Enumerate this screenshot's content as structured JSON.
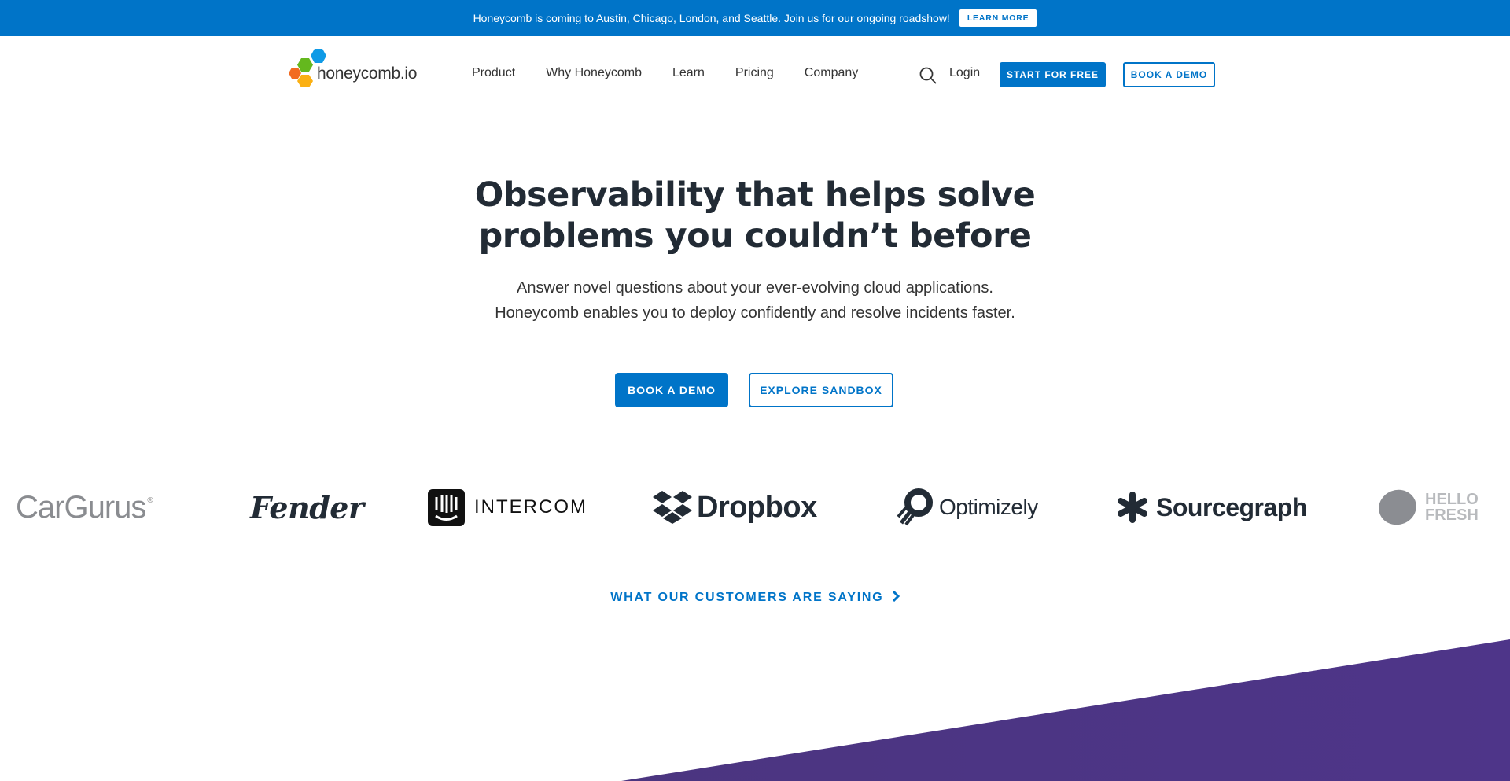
{
  "banner": {
    "text": "Honeycomb is coming to Austin, Chicago, London, and Seattle. Join us for our ongoing roadshow!",
    "button_label": "LEARN MORE",
    "background_color": "#0074c8"
  },
  "header": {
    "logo_text": "honeycomb.io",
    "nav_items": [
      {
        "label": "Product"
      },
      {
        "label": "Why Honeycomb"
      },
      {
        "label": "Learn"
      },
      {
        "label": "Pricing"
      },
      {
        "label": "Company"
      }
    ],
    "search_icon": "search-icon",
    "login_label": "Login",
    "start_button_label": "START FOR FREE",
    "demo_button_label": "BOOK A DEMO"
  },
  "hero": {
    "title_line1": "Observability that helps solve",
    "title_line2": "problems you couldn’t before",
    "subtitle_line1": "Answer novel questions about your ever-evolving cloud applications.",
    "subtitle_line2": "Honeycomb enables you to deploy confidently and resolve incidents faster.",
    "primary_cta": "BOOK A DEMO",
    "secondary_cta": "EXPLORE SANDBOX"
  },
  "customers": {
    "logos": [
      {
        "name": "CarGurus"
      },
      {
        "name": "Fender"
      },
      {
        "name": "INTERCOM"
      },
      {
        "name": "Dropbox"
      },
      {
        "name": "Optimizely"
      },
      {
        "name": "Sourcegraph"
      },
      {
        "name": "HELLO FRESH"
      }
    ],
    "link_label": "WHAT OUR CUSTOMERS ARE SAYING",
    "link_icon": "chevron-right-icon"
  },
  "colors": {
    "accent": "#0074c8",
    "heading": "#222b35",
    "purple": "#4d3585"
  }
}
